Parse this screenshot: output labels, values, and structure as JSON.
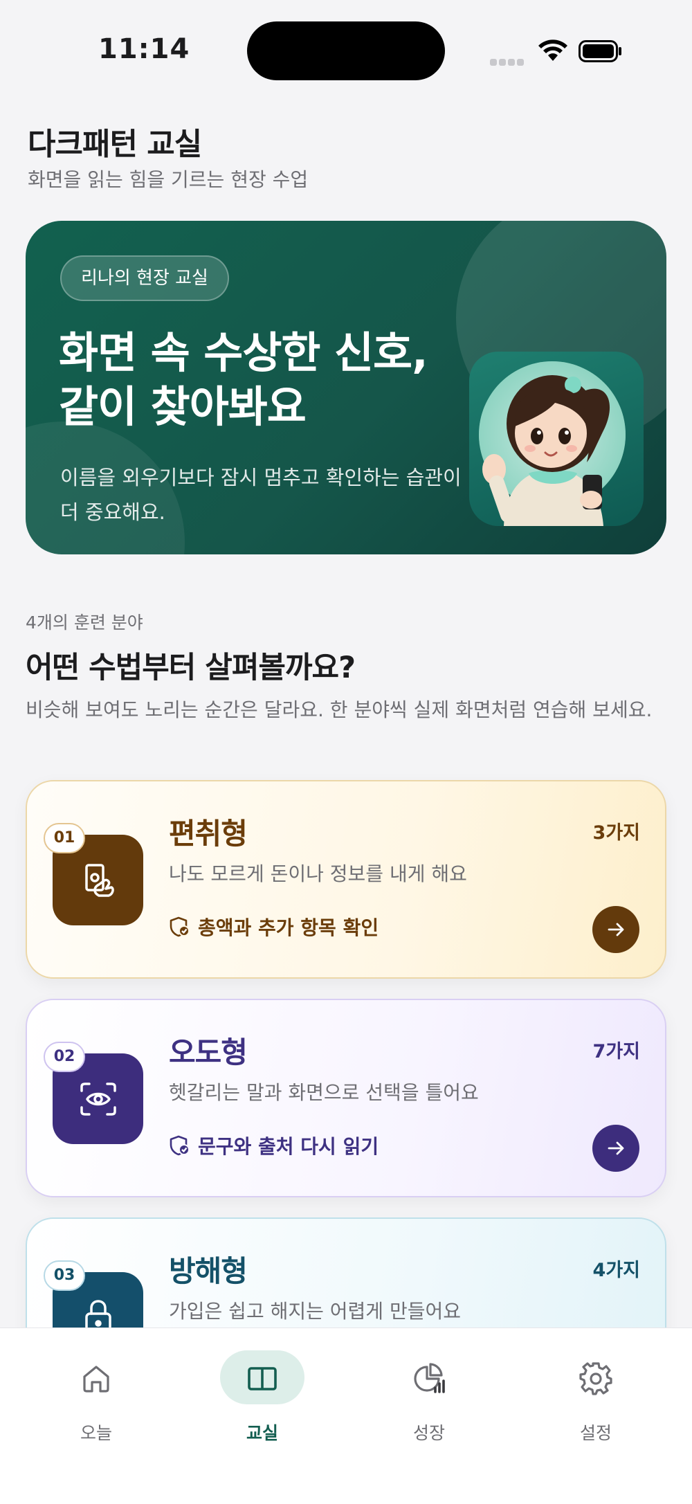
{
  "status": {
    "time": "11:14"
  },
  "header": {
    "title": "다크패턴 교실",
    "subtitle": "화면을 읽는 힘을 기르는 현장 수업"
  },
  "hero": {
    "badge": "리나의 현장 교실",
    "title_line1": "화면 속 수상한 신호,",
    "title_line2": "같이 찾아봐요",
    "description": "이름을 외우기보다 잠시 멈추고 확인하는 습관이 더 중요해요."
  },
  "section": {
    "eyebrow": "4개의 훈련 분야",
    "title": "어떤 수법부터 살펴볼까요?",
    "description": "비슷해 보여도 노리는 순간은 달라요. 한 분야씩 실제 화면처럼 연습해 보세요."
  },
  "cards": [
    {
      "number": "01",
      "name": "편취형",
      "count": "3가지",
      "description": "나도 모르게 돈이나 정보를 내게 해요",
      "tip": "총액과 추가 항목 확인",
      "icon": "hand-money-icon",
      "accent": "#633a0c"
    },
    {
      "number": "02",
      "name": "오도형",
      "count": "7가지",
      "description": "헷갈리는 말과 화면으로 선택을 틀어요",
      "tip": "문구와 출처 다시 읽기",
      "icon": "eye-scan-icon",
      "accent": "#3d2d7d"
    },
    {
      "number": "03",
      "name": "방해형",
      "count": "4가지",
      "description": "가입은 쉽고 해지는 어렵게 만들어요",
      "tip": "",
      "icon": "lock-icon",
      "accent": "#144f6b"
    }
  ],
  "tabs": [
    {
      "label": "오늘",
      "icon": "home-icon",
      "active": false
    },
    {
      "label": "교실",
      "icon": "book-open-icon",
      "active": true
    },
    {
      "label": "성장",
      "icon": "chart-pie-icon",
      "active": false
    },
    {
      "label": "설정",
      "icon": "gear-icon",
      "active": false
    }
  ],
  "colors": {
    "brand": "#135e50",
    "background": "#f4f4f6"
  }
}
